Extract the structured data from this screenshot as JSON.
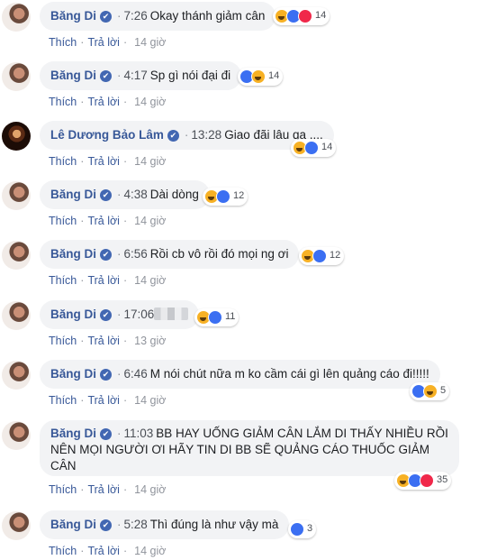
{
  "comments": [
    {
      "name": "Băng Di",
      "time": "7:26",
      "text": "Okay thánh giảm cân",
      "reactions": [
        "haha",
        "like",
        "love"
      ],
      "count": "14",
      "like_label": "Thích",
      "reply_label": "Trả lời",
      "age": "14 giờ",
      "avatar": "bang-di"
    },
    {
      "name": "Băng Di",
      "time": "4:17",
      "text": "Sp gì nói đại đi",
      "reactions": [
        "like",
        "haha"
      ],
      "count": "14",
      "like_label": "Thích",
      "reply_label": "Trả lời",
      "age": "14 giờ",
      "avatar": "bang-di"
    },
    {
      "name": "Lê Dương Bảo Lâm",
      "time": "13:28",
      "text": "Giao đãi lâu qa ....",
      "reactions": [
        "haha",
        "like"
      ],
      "count": "14",
      "like_label": "Thích",
      "reply_label": "Trả lời",
      "age": "14 giờ",
      "avatar": "bao-lam"
    },
    {
      "name": "Băng Di",
      "time": "4:38",
      "text": "Dài dòng",
      "reactions": [
        "haha",
        "like"
      ],
      "count": "12",
      "like_label": "Thích",
      "reply_label": "Trả lời",
      "age": "14 giờ",
      "avatar": "bang-di"
    },
    {
      "name": "Băng Di",
      "time": "6:56",
      "text": "Rồi cb vô rồi đó mọi ng ơi",
      "reactions": [
        "haha",
        "like"
      ],
      "count": "12",
      "like_label": "Thích",
      "reply_label": "Trả lời",
      "age": "14 giờ",
      "avatar": "bang-di"
    },
    {
      "name": "Băng Di",
      "time": "17:06",
      "text": "",
      "blurred": true,
      "reactions": [
        "haha",
        "like"
      ],
      "count": "11",
      "like_label": "Thích",
      "reply_label": "Trả lời",
      "age": "13 giờ",
      "avatar": "bang-di"
    },
    {
      "name": "Băng Di",
      "time": "6:46",
      "text": "M nói chút nữa m ko cầm cái gì lên quảng cáo đi!!!!!",
      "reactions": [
        "like",
        "haha"
      ],
      "count": "5",
      "like_label": "Thích",
      "reply_label": "Trả lời",
      "age": "14 giờ",
      "avatar": "bang-di"
    },
    {
      "name": "Băng Di",
      "time": "11:03",
      "text": "BB HAY UỐNG GIẢM CÂN LẮM DI THẤY NHIỀU RỒI NÊN MỌI NGƯỜI ƠI HÃY TIN DI BB SẼ QUẢNG CÁO THUỐC GIẢM CÂN",
      "reactions": [
        "haha",
        "like",
        "love"
      ],
      "count": "35",
      "like_label": "Thích",
      "reply_label": "Trả lời",
      "age": "14 giờ",
      "avatar": "bang-di"
    },
    {
      "name": "Băng Di",
      "time": "5:28",
      "text": "Thì đúng là như vậy mà",
      "reactions": [
        "like"
      ],
      "count": "3",
      "like_label": "Thích",
      "reply_label": "Trả lời",
      "age": "14 giờ",
      "avatar": "bang-di"
    }
  ],
  "verified_glyph": "✔",
  "separator": "·",
  "colors": {
    "name": "#385898",
    "bubble": "#f2f3f5",
    "like": "#3b6ff2",
    "haha": "#f7b125",
    "love": "#f0284a"
  }
}
